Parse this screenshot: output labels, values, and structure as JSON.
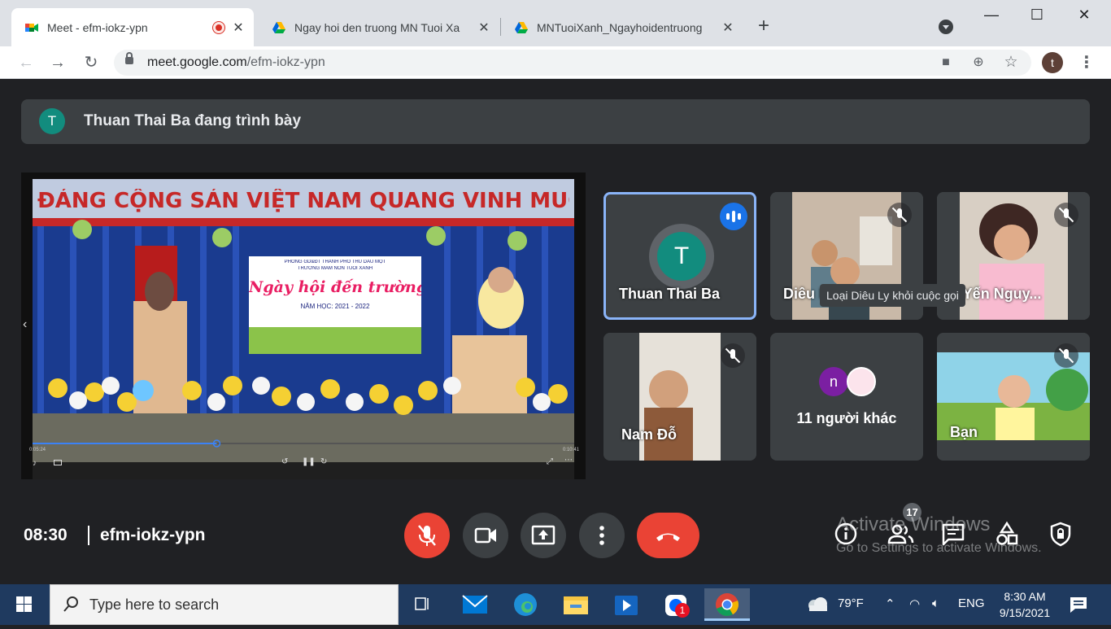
{
  "browser": {
    "tabs": [
      {
        "title": "Meet - efm-iokz-ypn",
        "active": true,
        "recording": true
      },
      {
        "title": "Ngay hoi den truong MN Tuoi Xa",
        "active": false
      },
      {
        "title": "MNTuoiXanh_Ngayhoidentruong",
        "active": false
      }
    ],
    "url_host": "meet.google.com",
    "url_path": "/efm-iokz-ypn",
    "profile_initial": "t"
  },
  "meet": {
    "banner_initial": "T",
    "banner_text": "Thuan Thai Ba đang trình bày",
    "participants": [
      {
        "name": "Thuan Thai Ba",
        "initial": "T",
        "speaking": true
      },
      {
        "name": "Diêu Ly",
        "muted": true
      },
      {
        "name": "i Yến Nguy...",
        "muted": true
      },
      {
        "name": "Nam Đỗ",
        "muted": true
      },
      {
        "name": "11 người khác",
        "initial": "n"
      },
      {
        "name": "Bạn",
        "muted": true
      }
    ],
    "tooltip": "Loại Diêu Ly khỏi cuộc gọi",
    "time": "08:30",
    "meeting_code": "efm-iokz-ypn",
    "participant_count": "17",
    "activate_title": "Activate Windows",
    "activate_sub": "Go to Settings to activate Windows."
  },
  "presentation": {
    "banner_text": "ĐẢNG CỘNG SẢN VIỆT NAM QUANG VINH MUÔN NĂM",
    "poster_line1": "PHÒNG GD&ĐT THÀNH PHỐ THỦ DẦU MỘT",
    "poster_line2": "TRƯỜNG MẦM NON TUỔI XANH",
    "poster_title": "Ngày hội đến trường của bé",
    "poster_year": "NĂM HỌC: 2021 - 2022",
    "time_elapsed": "0:05:24",
    "time_total": "0:10:41",
    "progress": 0.34
  },
  "taskbar": {
    "search_placeholder": "Type here to search",
    "weather": "79°F",
    "lang": "ENG",
    "time": "8:30 AM",
    "date": "9/15/2021",
    "zalo_badge": "1"
  },
  "colors": {
    "meet_bg": "#202124",
    "tile_bg": "#3c4043",
    "danger": "#ea4335",
    "speaking": "#8ab4f8"
  }
}
